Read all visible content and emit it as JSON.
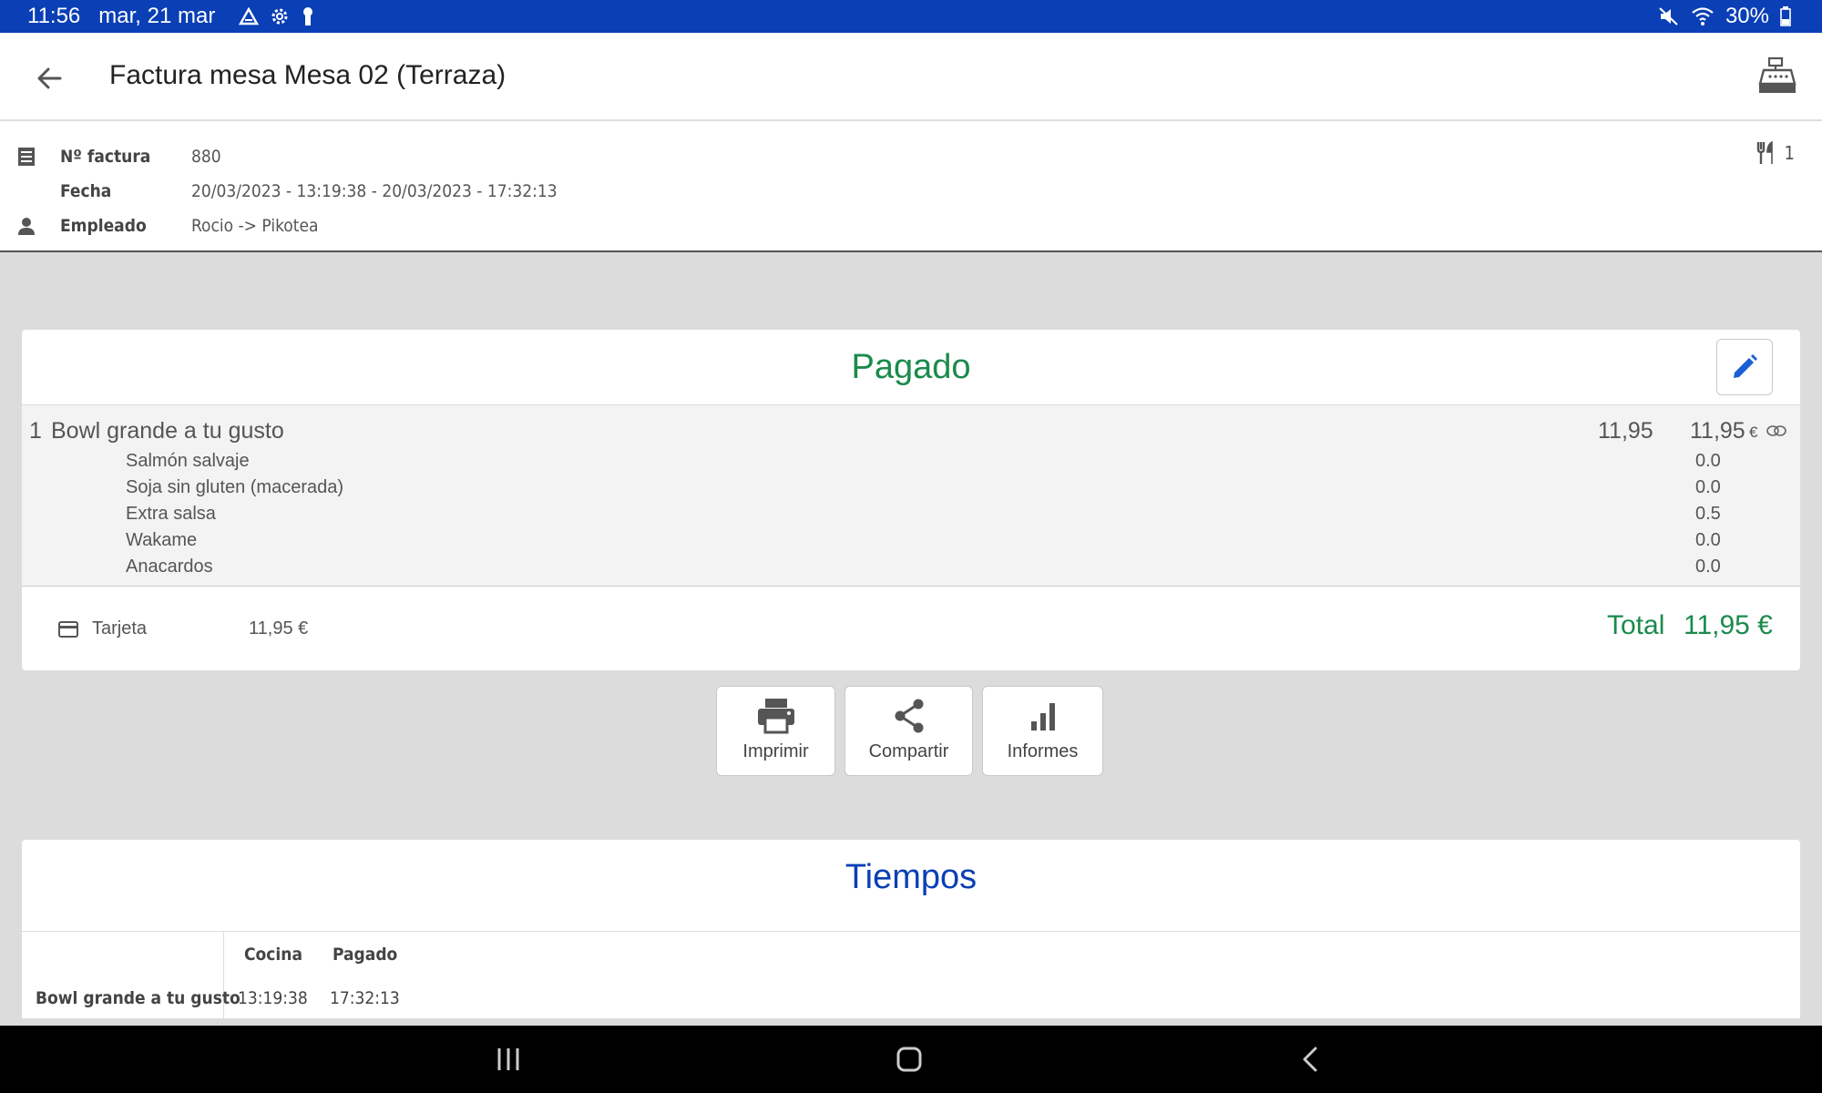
{
  "status_bar": {
    "time": "11:56",
    "date": "mar, 21 mar",
    "battery": "30%"
  },
  "app_bar": {
    "title": "Factura mesa Mesa 02 (Terraza)"
  },
  "invoice": {
    "number_label": "Nº factura",
    "number": "880",
    "date_label": "Fecha",
    "date": "20/03/2023 - 13:19:38 - 20/03/2023 - 17:32:13",
    "employee_label": "Empleado",
    "employee": "Rocio -> Pikotea",
    "covers": "1"
  },
  "paid": {
    "title": "Pagado",
    "line": {
      "qty": "1",
      "name": "Bowl grande a tu gusto",
      "unit_price": "11,95",
      "total": "11,95",
      "currency": "€"
    },
    "modifiers": [
      {
        "name": "Salmón salvaje",
        "price": "0.0"
      },
      {
        "name": "Soja sin gluten (macerada)",
        "price": "0.0"
      },
      {
        "name": "Extra salsa",
        "price": "0.5"
      },
      {
        "name": "Wakame",
        "price": "0.0"
      },
      {
        "name": "Anacardos",
        "price": "0.0"
      }
    ],
    "payment": {
      "method": "Tarjeta",
      "amount": "11,95 €"
    },
    "total_label": "Total",
    "total_value": "11,95 €"
  },
  "actions": {
    "print": "Imprimir",
    "share": "Compartir",
    "reports": "Informes"
  },
  "times": {
    "title": "Tiempos",
    "headers": [
      "Cocina",
      "Pagado"
    ],
    "rows": [
      {
        "name": "Bowl grande a tu gusto",
        "values": [
          "13:19:38",
          "17:32:13"
        ]
      }
    ]
  },
  "colors": {
    "status_bar": "#0a3fb5",
    "paid_green": "#1b8a4c",
    "times_blue": "#0a3fb5",
    "edit_blue": "#1a5fd6"
  }
}
